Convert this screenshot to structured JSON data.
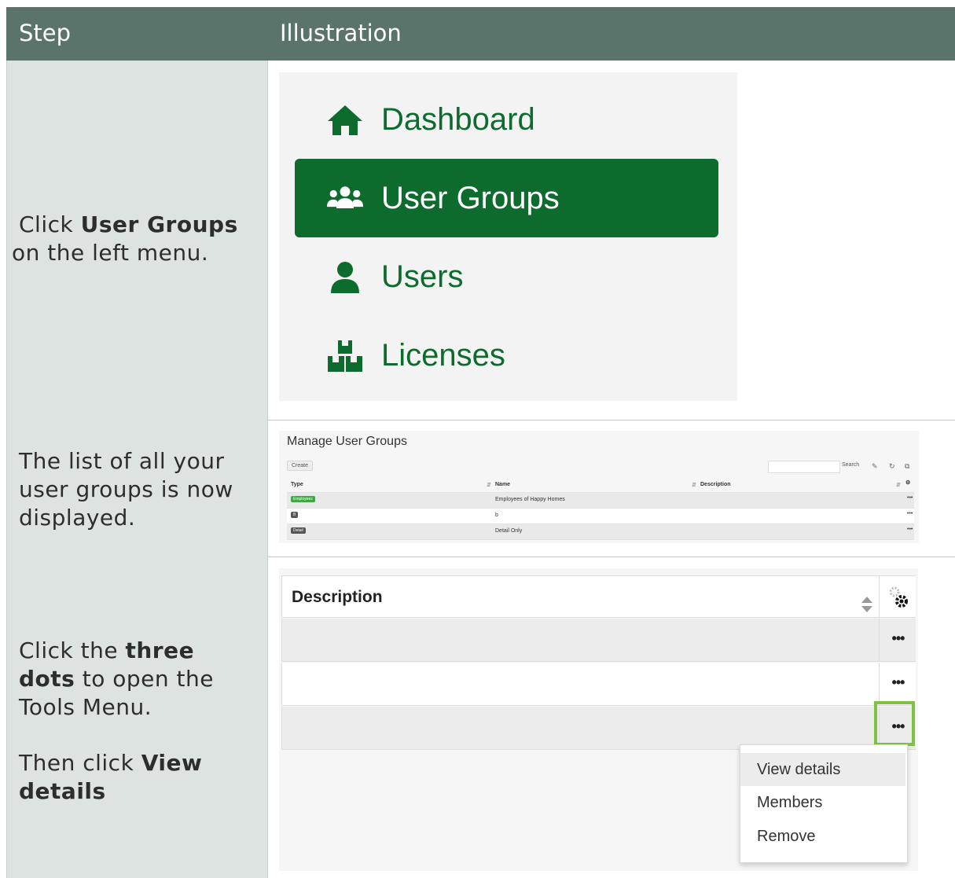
{
  "header": {
    "step": "Step",
    "illustration": "Illustration"
  },
  "steps": [
    {
      "parts": [
        "Click ",
        "User Groups",
        " on the left menu."
      ]
    },
    {
      "text": "The list of all your user groups is now displayed."
    },
    {
      "parts": [
        "Click the ",
        "three dots",
        " to open the Tools Menu."
      ],
      "then": [
        "Then click ",
        "View details"
      ]
    }
  ],
  "menu": {
    "items": [
      {
        "label": "Dashboard",
        "icon": "home-icon",
        "active": false
      },
      {
        "label": "User Groups",
        "icon": "user-group-icon",
        "active": true
      },
      {
        "label": "Users",
        "icon": "user-icon",
        "active": false
      },
      {
        "label": "Licenses",
        "icon": "licenses-icon",
        "active": false
      }
    ],
    "accent": "#0d6b2e"
  },
  "user_groups": {
    "title": "Manage User Groups",
    "create_label": "Create",
    "search_label": "Search",
    "columns": [
      "Type",
      "Name",
      "Description"
    ],
    "rows": [
      {
        "type": "Employees",
        "type_color": "#3fa845",
        "name": "Employees of Happy Homes",
        "description": ""
      },
      {
        "type": "B",
        "type_color": "#555555",
        "name": "b",
        "description": ""
      },
      {
        "type": "Detail",
        "type_color": "#555555",
        "name": "Detail Only",
        "description": ""
      }
    ],
    "row_action": "•••"
  },
  "tools": {
    "column_header": "Description",
    "row_action": "•••",
    "menu_items": [
      "View details",
      "Members",
      "Remove"
    ],
    "highlight_color": "#7ec242"
  }
}
